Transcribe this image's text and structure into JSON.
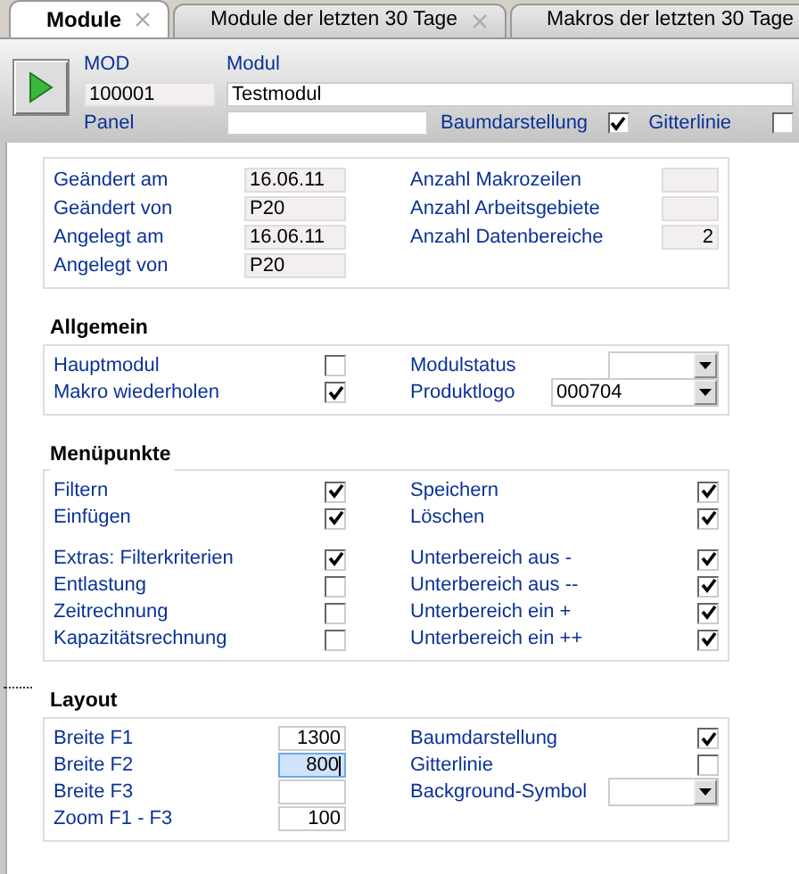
{
  "tabs": [
    {
      "label": "Module",
      "selected": true,
      "closable": true
    },
    {
      "label": "Module der letzten 30 Tage",
      "selected": false,
      "closable": true
    },
    {
      "label": "Makros der letzten 30 Tage",
      "selected": false,
      "closable": false
    }
  ],
  "header": {
    "mod_label": "MOD",
    "modul_label": "Modul",
    "mod_value": "100001",
    "modul_value": "Testmodul",
    "panel_label": "Panel",
    "options": [
      {
        "label": "Baumdarstellung",
        "checked": true
      },
      {
        "label": "Gitterlinie",
        "checked": false
      }
    ]
  },
  "groups": [
    {
      "blocks": [
        [
          {
            "left": {
              "label": "Geändert am",
              "kind": "readonly",
              "value": "16.06.11"
            },
            "right": {
              "label": "Anzahl Makrozeilen",
              "kind": "readonly"
            }
          },
          {
            "left": {
              "label": "Geändert von",
              "kind": "readonly",
              "value": "P20"
            },
            "right": {
              "label": "Anzahl Arbeitsgebiete",
              "kind": "readonly"
            }
          },
          {
            "left": {
              "label": "Angelegt am",
              "kind": "readonly",
              "value": "16.06.11"
            },
            "right": {
              "label": "Anzahl Datenbereiche",
              "kind": "readonly",
              "value": "2"
            }
          },
          {
            "left": {
              "label": "Angelegt von",
              "kind": "readonly",
              "value": "P20"
            }
          }
        ]
      ]
    },
    {
      "title": "Allgemein",
      "blocks": [
        [
          {
            "left": {
              "label": "Hauptmodul",
              "kind": "check",
              "checked": false
            },
            "right": {
              "label": "Modulstatus",
              "kind": "select"
            }
          },
          {
            "left": {
              "label": "Makro wiederholen",
              "kind": "check",
              "checked": true
            },
            "right": {
              "label": "Produktlogo",
              "kind": "select",
              "value": "000704"
            }
          }
        ]
      ]
    },
    {
      "title": "Menüpunkte",
      "blocks": [
        [
          {
            "left": {
              "label": "Filtern",
              "kind": "check",
              "checked": true
            },
            "right": {
              "label": "Speichern",
              "kind": "check",
              "checked": true
            }
          },
          {
            "left": {
              "label": "Einfügen",
              "kind": "check",
              "checked": true
            },
            "right": {
              "label": "Löschen",
              "kind": "check",
              "checked": true
            }
          }
        ],
        [
          {
            "left": {
              "label": "Extras: Filterkriterien",
              "kind": "check",
              "checked": true
            },
            "right": {
              "label": "Unterbereich aus -",
              "kind": "check",
              "checked": true
            }
          },
          {
            "left": {
              "label": "Entlastung",
              "kind": "check",
              "checked": false
            },
            "right": {
              "label": "Unterbereich aus --",
              "kind": "check",
              "checked": true
            }
          },
          {
            "left": {
              "label": "Zeitrechnung",
              "kind": "check",
              "checked": false
            },
            "right": {
              "label": "Unterbereich ein +",
              "kind": "check",
              "checked": true
            }
          },
          {
            "left": {
              "label": "Kapazitätsrechnung",
              "kind": "check",
              "checked": false
            },
            "right": {
              "label": "Unterbereich ein ++",
              "kind": "check",
              "checked": true
            }
          }
        ]
      ]
    },
    {
      "title": "Layout",
      "blocks": [
        [
          {
            "left": {
              "label": "Breite F1",
              "kind": "input",
              "value": "1300",
              "focused": false
            },
            "right": {
              "label": "Baumdarstellung",
              "kind": "check",
              "checked": true
            }
          },
          {
            "left": {
              "label": "Breite F2",
              "kind": "input",
              "value": "800",
              "focused": true
            },
            "right": {
              "label": "Gitterlinie",
              "kind": "check",
              "checked": false
            }
          },
          {
            "left": {
              "label": "Breite F3",
              "kind": "input",
              "focused": false
            },
            "right": {
              "label": "Background-Symbol",
              "kind": "select"
            }
          },
          {
            "left": {
              "label": "Zoom F1 - F3",
              "kind": "input",
              "value": "100",
              "focused": false
            }
          }
        ]
      ]
    }
  ]
}
